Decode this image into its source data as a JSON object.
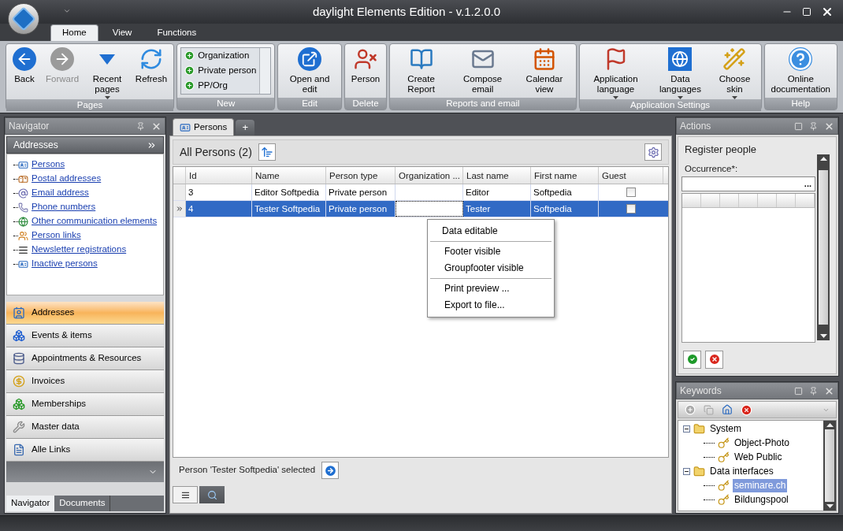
{
  "window": {
    "title": "daylight Elements Edition - v.1.2.0.0"
  },
  "ribbon": {
    "tabs": [
      {
        "label": "Home",
        "selected": true
      },
      {
        "label": "View",
        "selected": false
      },
      {
        "label": "Functions",
        "selected": false
      }
    ],
    "groups": [
      {
        "label": "Pages",
        "kind": "buttons",
        "items": [
          {
            "label": "Back",
            "disabled": false,
            "dropdown": false
          },
          {
            "label": "Forward",
            "disabled": true,
            "dropdown": false
          },
          {
            "label": "Recent pages",
            "disabled": false,
            "dropdown": true
          },
          {
            "label": "Refresh",
            "disabled": false,
            "dropdown": false
          }
        ]
      },
      {
        "label": "New",
        "kind": "list",
        "items": [
          {
            "label": "Organization"
          },
          {
            "label": "Private person"
          },
          {
            "label": "PP/Org"
          }
        ]
      },
      {
        "label": "Edit",
        "kind": "buttons",
        "items": [
          {
            "label": "Open and edit",
            "disabled": false,
            "dropdown": false
          }
        ]
      },
      {
        "label": "Delete",
        "kind": "buttons",
        "items": [
          {
            "label": "Person",
            "disabled": false,
            "dropdown": false
          }
        ]
      },
      {
        "label": "Reports and email",
        "kind": "buttons",
        "items": [
          {
            "label": "Create Report",
            "disabled": false,
            "dropdown": false
          },
          {
            "label": "Compose email",
            "disabled": false,
            "dropdown": false
          },
          {
            "label": "Calendar view",
            "disabled": false,
            "dropdown": false
          }
        ]
      },
      {
        "label": "Application Settings",
        "kind": "buttons",
        "items": [
          {
            "label": "Application language",
            "disabled": false,
            "dropdown": true
          },
          {
            "label": "Data languages",
            "disabled": false,
            "dropdown": true
          },
          {
            "label": "Choose skin",
            "disabled": false,
            "dropdown": true
          }
        ]
      },
      {
        "label": "Help",
        "kind": "buttons",
        "items": [
          {
            "label": "Online documentation",
            "disabled": false,
            "dropdown": false
          }
        ]
      }
    ]
  },
  "navigator": {
    "title": "Navigator",
    "section": "Addresses",
    "links": [
      {
        "label": "Persons"
      },
      {
        "label": "Postal addresses"
      },
      {
        "label": "Email address"
      },
      {
        "label": "Phone numbers"
      },
      {
        "label": "Other communication elements"
      },
      {
        "label": "Person links"
      },
      {
        "label": "Newsletter registrations"
      },
      {
        "label": "Inactive persons"
      }
    ],
    "modules": [
      {
        "label": "Addresses",
        "selected": true
      },
      {
        "label": "Events & items",
        "selected": false
      },
      {
        "label": "Appointments & Resources",
        "selected": false
      },
      {
        "label": "Invoices",
        "selected": false
      },
      {
        "label": "Memberships",
        "selected": false
      },
      {
        "label": "Master data",
        "selected": false
      },
      {
        "label": "Alle Links",
        "selected": false
      }
    ],
    "tabs": [
      {
        "label": "Navigator",
        "selected": true
      },
      {
        "label": "Documents",
        "selected": false
      }
    ]
  },
  "document": {
    "tabs": [
      {
        "label": "Persons",
        "selected": true
      }
    ],
    "new_tab": "+",
    "heading": "All Persons (2)",
    "table": {
      "columns": [
        "Id",
        "Name",
        "Person type",
        "Organization ...",
        "Last name",
        "First name",
        "Guest"
      ],
      "rows": [
        {
          "selected": false,
          "cells": [
            "3",
            "Editor Softpedia",
            "Private person",
            "",
            "Editor",
            "Softpedia"
          ],
          "guest": false
        },
        {
          "selected": true,
          "cells": [
            "4",
            "Tester Softpedia",
            "Private person",
            "",
            "Tester",
            "Softpedia"
          ],
          "guest": false
        }
      ]
    },
    "context_menu": [
      [
        "Data editable"
      ],
      [
        "Footer visible",
        "Groupfooter visible"
      ],
      [
        "Print preview ...",
        "Export to file..."
      ]
    ],
    "status": "Person 'Tester Softpedia' selected",
    "bottom_tabs": [
      {
        "selected": true
      },
      {
        "selected": false
      }
    ]
  },
  "actions": {
    "title": "Actions",
    "heading": "Register people",
    "field_label": "Occurrence*:",
    "browse": "..."
  },
  "keywords": {
    "title": "Keywords",
    "tree": [
      {
        "label": "System",
        "expanded": true,
        "children": [
          {
            "label": "Object-Photo",
            "selected": false
          },
          {
            "label": "Web Public",
            "selected": false
          }
        ]
      },
      {
        "label": "Data interfaces",
        "expanded": true,
        "children": [
          {
            "label": "seminare.ch",
            "selected": true
          },
          {
            "label": "Bildungspool",
            "selected": false
          }
        ]
      }
    ]
  }
}
